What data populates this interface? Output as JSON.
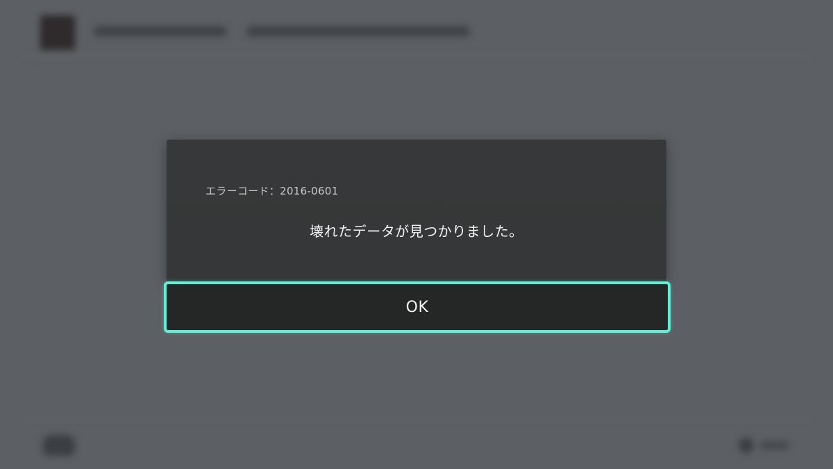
{
  "dialog": {
    "error_code": "エラーコード：2016-0601",
    "message": "壊れたデータが見つかりました。",
    "ok_label": "OK"
  },
  "colors": {
    "background": "#5c5f63",
    "dialog": "#373839",
    "button": "#242726",
    "focus_outline": "#5cf0d8"
  },
  "icons": {
    "game_thumbnail": "game-thumbnail-icon",
    "controller": "controller-icon",
    "button_hint": "button-hint-icon"
  }
}
